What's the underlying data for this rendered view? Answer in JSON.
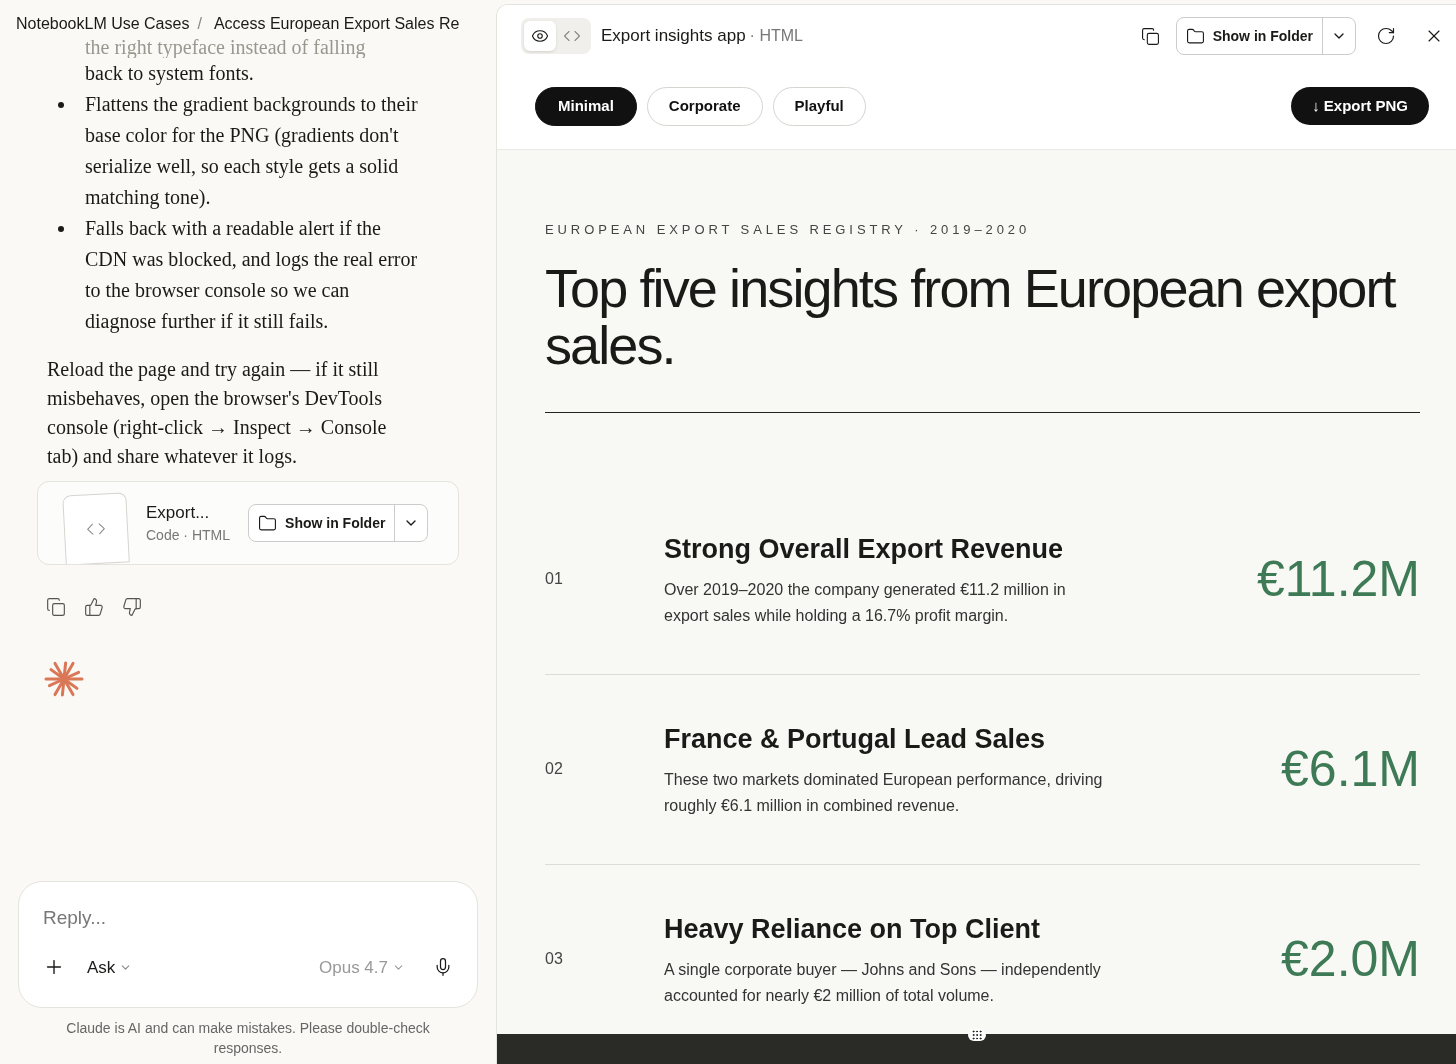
{
  "breadcrumb": {
    "items": [
      "NotebookLM Use Cases",
      "Access European Export Sales Re"
    ],
    "separator": "/"
  },
  "meta_separator": "·",
  "chat": {
    "faded_line": "the right typeface instead of falling",
    "bullet_continuation": "back to system fonts.",
    "bullets": [
      "Flattens the gradient backgrounds to their base color for the PNG (gradients don't serialize well, so each style gets a solid matching tone).",
      "Falls back with a readable alert if the CDN was blocked, and logs the real error to the browser console so we can diagnose further if it still fails."
    ],
    "paragraph": "Reload the page and try again — if it still misbehaves, open the browser's DevTools console (right-click → Inspect → Console tab) and share whatever it logs.",
    "artifact": {
      "title": "Export...",
      "kind_label": "Code",
      "type_label": "HTML",
      "button": "Show in Folder"
    }
  },
  "composer": {
    "placeholder": "Reply...",
    "mode": "Ask",
    "model": "Opus 4.7",
    "disclaimer": "Claude is AI and can make mistakes. Please double-check responses."
  },
  "preview": {
    "view_modes": [
      {
        "kind": "preview",
        "selected": true
      },
      {
        "kind": "code",
        "selected": false
      }
    ],
    "title": "Export insights app",
    "type_label": "HTML",
    "folder_button": "Show in Folder",
    "styles": [
      {
        "label": "Minimal",
        "selected": true
      },
      {
        "label": "Corporate",
        "selected": false
      },
      {
        "label": "Playful",
        "selected": false
      }
    ],
    "export_button": "↓ Export PNG",
    "document": {
      "eyebrow": "EUROPEAN EXPORT SALES REGISTRY · 2019–2020",
      "headline": "Top five insights from European export sales.",
      "insights": [
        {
          "number": "01",
          "title": "Strong Overall Export Revenue",
          "body": "Over 2019–2020 the company generated €11.2 million in export sales while holding a 16.7% profit margin.",
          "value": "€11.2M"
        },
        {
          "number": "02",
          "title": "France & Portugal Lead Sales",
          "body": "These two markets dominated European performance, driving roughly €6.1 million in combined revenue.",
          "value": "€6.1M"
        },
        {
          "number": "03",
          "title": "Heavy Reliance on Top Client",
          "body": "A single corporate buyer — Johns and Sons — independently accounted for nearly €2 million of total volume.",
          "value": "€2.0M"
        }
      ]
    }
  }
}
